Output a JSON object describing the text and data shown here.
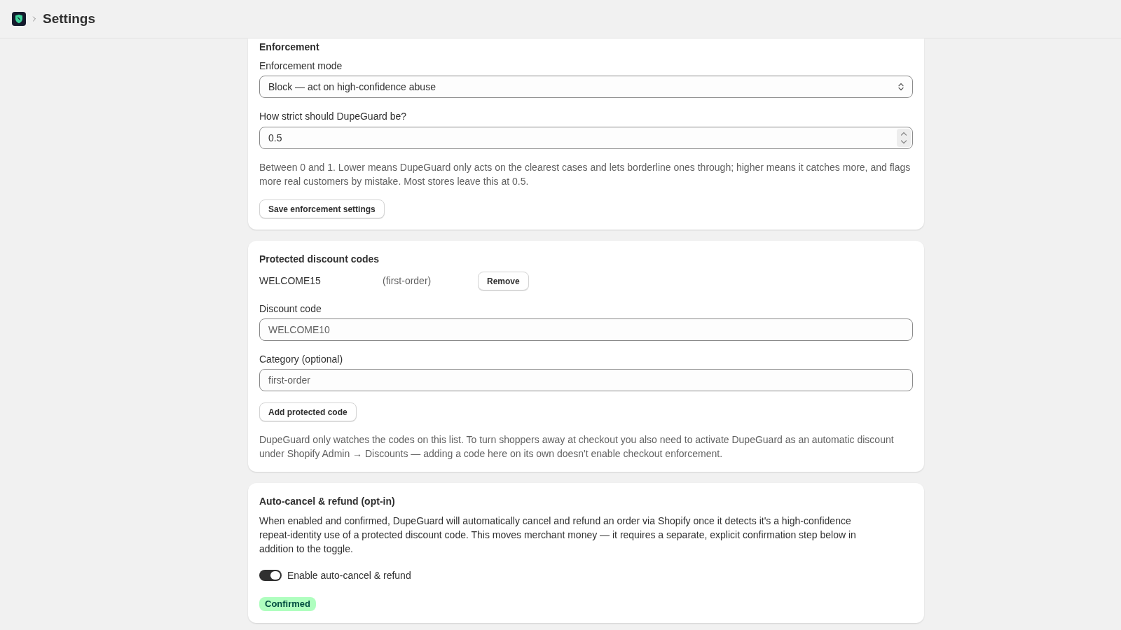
{
  "header": {
    "title": "Settings"
  },
  "enforcement": {
    "title": "Enforcement",
    "mode_field": {
      "label": "Enforcement mode",
      "value": "Block — act on high-confidence abuse"
    },
    "strictness_field": {
      "label": "How strict should DupeGuard be?",
      "value": "0.5"
    },
    "help_text": "Between 0 and 1. Lower means DupeGuard only acts on the clearest cases and lets borderline ones through; higher means it catches more, and flags more real customers by mistake. Most stores leave this at 0.5.",
    "save_button": "Save enforcement settings"
  },
  "protected_codes": {
    "title": "Protected discount codes",
    "codes": [
      {
        "code": "WELCOME15",
        "category": "(first-order)",
        "action": "Remove"
      }
    ],
    "code_field": {
      "label": "Discount code",
      "placeholder": "WELCOME10"
    },
    "category_field": {
      "label": "Category (optional)",
      "placeholder": "first-order"
    },
    "add_button": "Add protected code",
    "note": "DupeGuard only watches the codes on this list. To turn shoppers away at checkout you also need to activate DupeGuard as an automatic discount under Shopify Admin → Discounts — adding a code here on its own doesn't enable checkout enforcement."
  },
  "auto_cancel": {
    "title": "Auto-cancel & refund (opt-in)",
    "description": "When enabled and confirmed, DupeGuard will automatically cancel and refund an order via Shopify once it detects it's a high-confidence repeat-identity use of a protected discount code. This moves merchant money — it requires a separate, explicit confirmation step below in addition to the toggle.",
    "toggle": {
      "label": "Enable auto-cancel & refund",
      "on": true
    },
    "status_badge": "Confirmed"
  }
}
